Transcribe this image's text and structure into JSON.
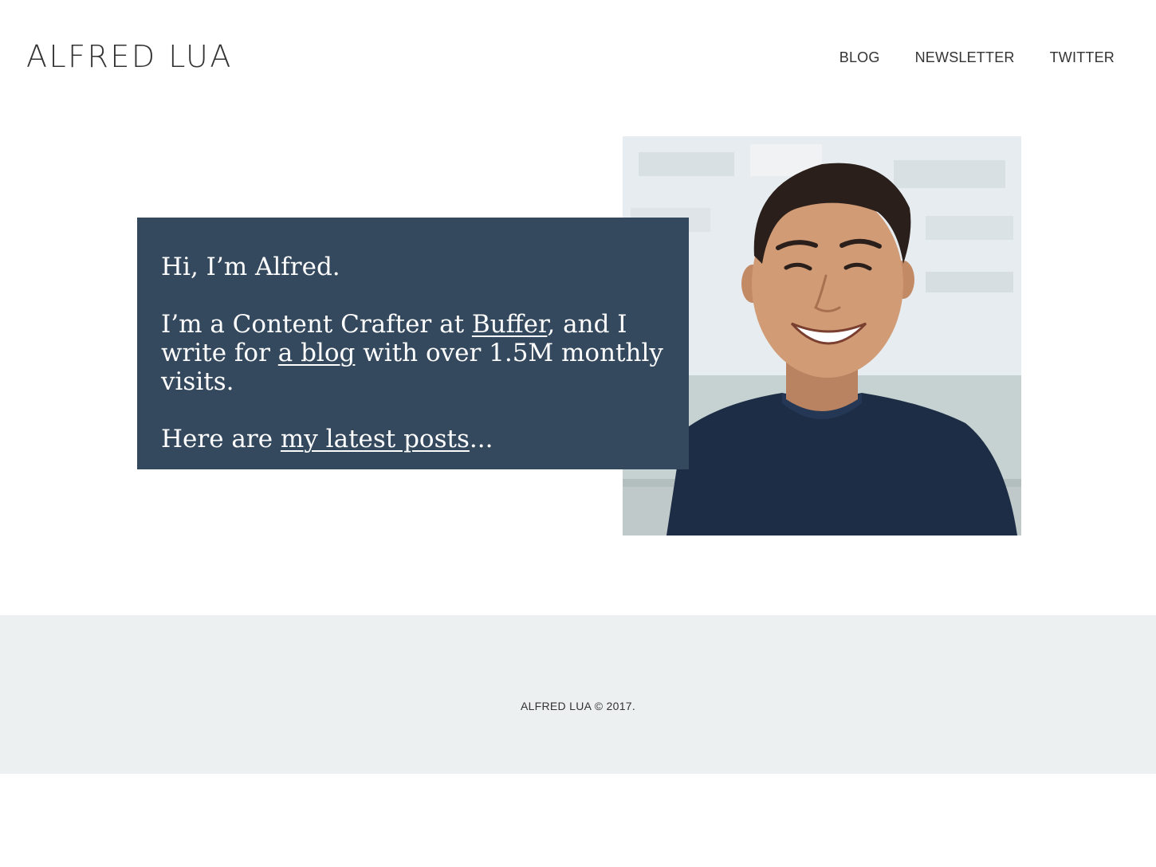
{
  "header": {
    "logo": "ALFRED LUA",
    "nav": [
      {
        "label": "BLOG"
      },
      {
        "label": "NEWSLETTER"
      },
      {
        "label": "TWITTER"
      }
    ]
  },
  "intro": {
    "greeting": "Hi, I’m Alfred.",
    "line2_before": "I’m a Content Crafter at ",
    "line2_link1": "Buffer",
    "line2_middle": ", and I write for ",
    "line2_link2": "a blog",
    "line2_after": " with over 1.5M monthly visits.",
    "line3_before": "Here are ",
    "line3_link": "my latest posts",
    "line3_after": "..."
  },
  "footer": {
    "copyright": "ALFRED LUA © 2017."
  },
  "colors": {
    "card_background": "#34495e",
    "footer_background": "#ecf0f1",
    "text": "#333333"
  }
}
